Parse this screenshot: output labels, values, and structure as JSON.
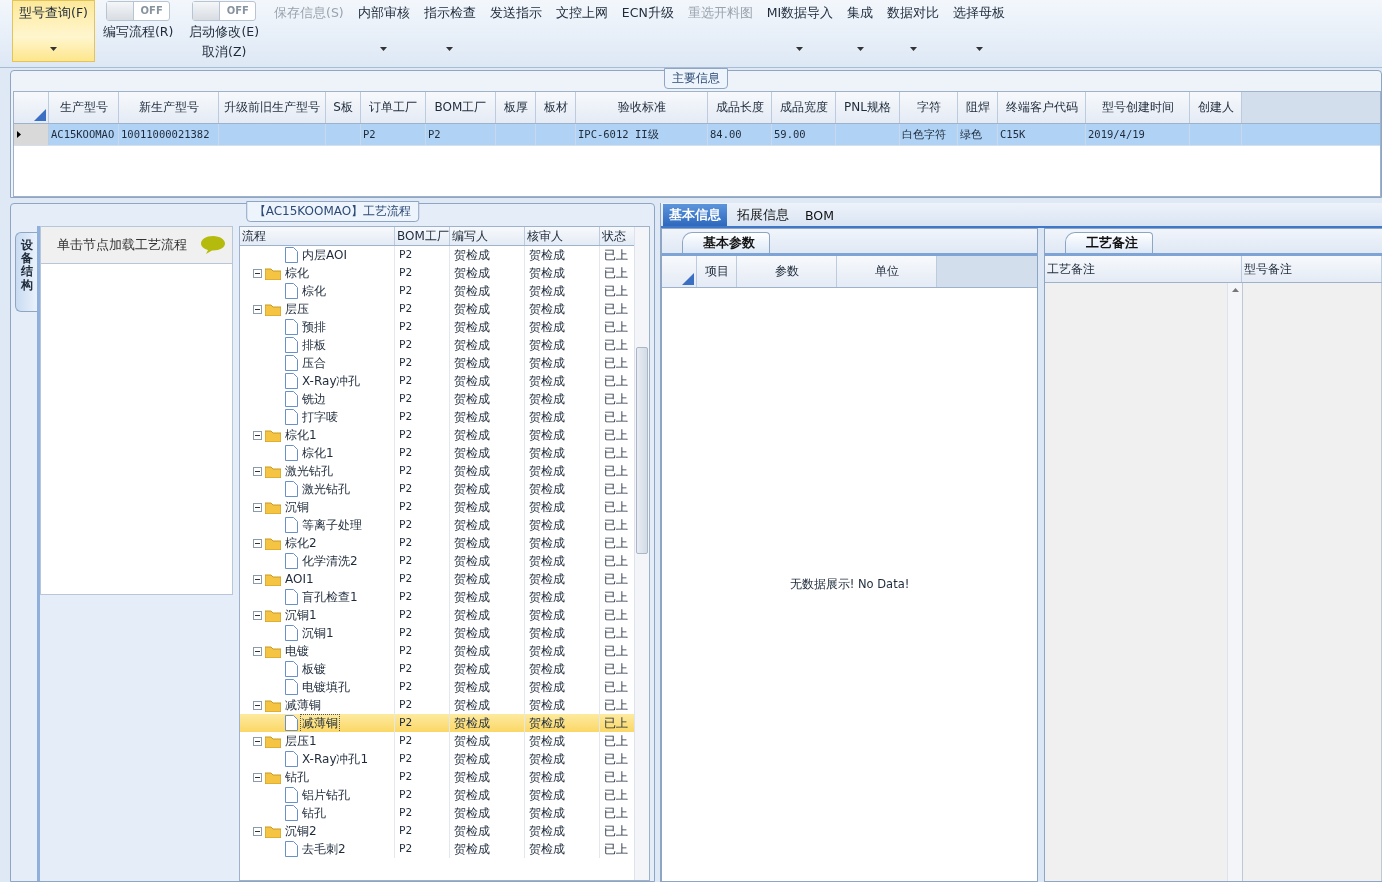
{
  "toolbar": [
    {
      "kind": "button",
      "label": "型号查询(F)",
      "selected": true,
      "disabled": false,
      "dropdown": true
    },
    {
      "kind": "toggle",
      "switch_text": "OFF",
      "label": "编写流程(R)",
      "selected": false,
      "disabled": false
    },
    {
      "kind": "toggle",
      "switch_text": "OFF",
      "label": "启动修改(E)",
      "sublabel": "取消(Z)",
      "selected": false,
      "disabled": false
    },
    {
      "kind": "button",
      "label": "保存信息(S)",
      "selected": false,
      "disabled": true,
      "dropdown": false
    },
    {
      "kind": "button",
      "label": "内部审核",
      "selected": false,
      "disabled": false,
      "dropdown": true
    },
    {
      "kind": "button",
      "label": "指示检查",
      "selected": false,
      "disabled": false,
      "dropdown": true
    },
    {
      "kind": "button",
      "label": "发送指示",
      "selected": false,
      "disabled": false,
      "dropdown": false
    },
    {
      "kind": "button",
      "label": "文控上网",
      "selected": false,
      "disabled": false,
      "dropdown": false
    },
    {
      "kind": "button",
      "label": "ECN升级",
      "selected": false,
      "disabled": false,
      "dropdown": false
    },
    {
      "kind": "button",
      "label": "重选开料图",
      "selected": false,
      "disabled": true,
      "dropdown": false
    },
    {
      "kind": "button",
      "label": "MI数据导入",
      "selected": false,
      "disabled": false,
      "dropdown": true
    },
    {
      "kind": "button",
      "label": "集成",
      "selected": false,
      "disabled": false,
      "dropdown": true
    },
    {
      "kind": "button",
      "label": "数据对比",
      "selected": false,
      "disabled": false,
      "dropdown": true
    },
    {
      "kind": "button",
      "label": "选择母板",
      "selected": false,
      "disabled": false,
      "dropdown": true
    }
  ],
  "main_info": {
    "title": "主要信息",
    "columns": [
      "生产型号",
      "新生产型号",
      "升级前旧生产型号",
      "S板",
      "订单工厂",
      "BOM工厂",
      "板厚",
      "板材",
      "验收标准",
      "成品长度",
      "成品宽度",
      "PNL规格",
      "字符",
      "阻焊",
      "终端客户代码",
      "型号创建时间",
      "创建人"
    ],
    "rows": [
      {
        "selected": true,
        "cells": [
          "AC15KOOMAO",
          "10011000021382",
          "",
          "",
          "P2",
          "P2",
          "",
          "",
          "IPC-6012 II级",
          "84.00",
          "59.00",
          "",
          "白色字符",
          "绿色",
          "C15K",
          "2019/4/19",
          ""
        ]
      }
    ]
  },
  "process": {
    "title": "【AC15KOOMAO】工艺流程",
    "side_tab": "设备结构",
    "hint": "单击节点加载工艺流程",
    "columns": [
      "流程",
      "BOM工厂",
      "编写人",
      "核审人",
      "状态"
    ],
    "tree": [
      {
        "kind": "leaf",
        "label": "内层AOI",
        "selected": false,
        "bom": "P2",
        "writer": "贺检成",
        "reviewer": "贺检成",
        "status": "已上"
      },
      {
        "kind": "folder",
        "label": "棕化",
        "expanded": true,
        "selected": false,
        "bom": "P2",
        "writer": "贺检成",
        "reviewer": "贺检成",
        "status": "已上",
        "children": [
          {
            "kind": "leaf",
            "label": "棕化",
            "selected": false,
            "bom": "P2",
            "writer": "贺检成",
            "reviewer": "贺检成",
            "status": "已上"
          }
        ]
      },
      {
        "kind": "folder",
        "label": "层压",
        "expanded": true,
        "selected": false,
        "bom": "P2",
        "writer": "贺检成",
        "reviewer": "贺检成",
        "status": "已上",
        "children": [
          {
            "kind": "leaf",
            "label": "预排",
            "selected": false,
            "bom": "P2",
            "writer": "贺检成",
            "reviewer": "贺检成",
            "status": "已上"
          },
          {
            "kind": "leaf",
            "label": "排板",
            "selected": false,
            "bom": "P2",
            "writer": "贺检成",
            "reviewer": "贺检成",
            "status": "已上"
          },
          {
            "kind": "leaf",
            "label": "压合",
            "selected": false,
            "bom": "P2",
            "writer": "贺检成",
            "reviewer": "贺检成",
            "status": "已上"
          },
          {
            "kind": "leaf",
            "label": "X-Ray冲孔",
            "selected": false,
            "bom": "P2",
            "writer": "贺检成",
            "reviewer": "贺检成",
            "status": "已上"
          },
          {
            "kind": "leaf",
            "label": "铣边",
            "selected": false,
            "bom": "P2",
            "writer": "贺检成",
            "reviewer": "贺检成",
            "status": "已上"
          },
          {
            "kind": "leaf",
            "label": "打字唛",
            "selected": false,
            "bom": "P2",
            "writer": "贺检成",
            "reviewer": "贺检成",
            "status": "已上"
          }
        ]
      },
      {
        "kind": "folder",
        "label": "棕化1",
        "expanded": true,
        "selected": false,
        "bom": "P2",
        "writer": "贺检成",
        "reviewer": "贺检成",
        "status": "已上",
        "children": [
          {
            "kind": "leaf",
            "label": "棕化1",
            "selected": false,
            "bom": "P2",
            "writer": "贺检成",
            "reviewer": "贺检成",
            "status": "已上"
          }
        ]
      },
      {
        "kind": "folder",
        "label": "激光钻孔",
        "expanded": true,
        "selected": false,
        "bom": "P2",
        "writer": "贺检成",
        "reviewer": "贺检成",
        "status": "已上",
        "children": [
          {
            "kind": "leaf",
            "label": "激光钻孔",
            "selected": false,
            "bom": "P2",
            "writer": "贺检成",
            "reviewer": "贺检成",
            "status": "已上"
          }
        ]
      },
      {
        "kind": "folder",
        "label": "沉铜",
        "expanded": true,
        "selected": false,
        "bom": "P2",
        "writer": "贺检成",
        "reviewer": "贺检成",
        "status": "已上",
        "children": [
          {
            "kind": "leaf",
            "label": "等离子处理",
            "selected": false,
            "bom": "P2",
            "writer": "贺检成",
            "reviewer": "贺检成",
            "status": "已上"
          }
        ]
      },
      {
        "kind": "folder",
        "label": "棕化2",
        "expanded": true,
        "selected": false,
        "bom": "P2",
        "writer": "贺检成",
        "reviewer": "贺检成",
        "status": "已上",
        "children": [
          {
            "kind": "leaf",
            "label": "化学清洗2",
            "selected": false,
            "bom": "P2",
            "writer": "贺检成",
            "reviewer": "贺检成",
            "status": "已上"
          }
        ]
      },
      {
        "kind": "folder",
        "label": "AOI1",
        "expanded": true,
        "selected": false,
        "bom": "P2",
        "writer": "贺检成",
        "reviewer": "贺检成",
        "status": "已上",
        "children": [
          {
            "kind": "leaf",
            "label": "盲孔检查1",
            "selected": false,
            "bom": "P2",
            "writer": "贺检成",
            "reviewer": "贺检成",
            "status": "已上"
          }
        ]
      },
      {
        "kind": "folder",
        "label": "沉铜1",
        "expanded": true,
        "selected": false,
        "bom": "P2",
        "writer": "贺检成",
        "reviewer": "贺检成",
        "status": "已上",
        "children": [
          {
            "kind": "leaf",
            "label": "沉铜1",
            "selected": false,
            "bom": "P2",
            "writer": "贺检成",
            "reviewer": "贺检成",
            "status": "已上"
          }
        ]
      },
      {
        "kind": "folder",
        "label": "电镀",
        "expanded": true,
        "selected": false,
        "bom": "P2",
        "writer": "贺检成",
        "reviewer": "贺检成",
        "status": "已上",
        "children": [
          {
            "kind": "leaf",
            "label": "板镀",
            "selected": false,
            "bom": "P2",
            "writer": "贺检成",
            "reviewer": "贺检成",
            "status": "已上"
          },
          {
            "kind": "leaf",
            "label": "电镀填孔",
            "selected": false,
            "bom": "P2",
            "writer": "贺检成",
            "reviewer": "贺检成",
            "status": "已上"
          }
        ]
      },
      {
        "kind": "folder",
        "label": "减薄铜",
        "expanded": true,
        "selected": false,
        "bom": "P2",
        "writer": "贺检成",
        "reviewer": "贺检成",
        "status": "已上",
        "children": [
          {
            "kind": "leaf",
            "label": "减薄铜",
            "selected": true,
            "bom": "P2",
            "writer": "贺检成",
            "reviewer": "贺检成",
            "status": "已上"
          }
        ]
      },
      {
        "kind": "folder",
        "label": "层压1",
        "expanded": true,
        "selected": false,
        "bom": "P2",
        "writer": "贺检成",
        "reviewer": "贺检成",
        "status": "已上",
        "children": [
          {
            "kind": "leaf",
            "label": "X-Ray冲孔1",
            "selected": false,
            "bom": "P2",
            "writer": "贺检成",
            "reviewer": "贺检成",
            "status": "已上"
          }
        ]
      },
      {
        "kind": "folder",
        "label": "钻孔",
        "expanded": true,
        "selected": false,
        "bom": "P2",
        "writer": "贺检成",
        "reviewer": "贺检成",
        "status": "已上",
        "children": [
          {
            "kind": "leaf",
            "label": "铝片钻孔",
            "selected": false,
            "bom": "P2",
            "writer": "贺检成",
            "reviewer": "贺检成",
            "status": "已上"
          },
          {
            "kind": "leaf",
            "label": "钻孔",
            "selected": false,
            "bom": "P2",
            "writer": "贺检成",
            "reviewer": "贺检成",
            "status": "已上"
          }
        ]
      },
      {
        "kind": "folder",
        "label": "沉铜2",
        "expanded": true,
        "selected": false,
        "bom": "P2",
        "writer": "贺检成",
        "reviewer": "贺检成",
        "status": "已上",
        "children": [
          {
            "kind": "leaf",
            "label": "去毛刺2",
            "selected": false,
            "bom": "P2",
            "writer": "贺检成",
            "reviewer": "贺检成",
            "status": "已上"
          }
        ]
      }
    ]
  },
  "detail_tabs": [
    {
      "label": "基本信息",
      "selected": true
    },
    {
      "label": "拓展信息",
      "selected": false
    },
    {
      "label": "BOM",
      "selected": false
    }
  ],
  "basic_params": {
    "tab": "基本参数",
    "columns": [
      "项目",
      "参数",
      "单位"
    ],
    "empty_text": "无数据展示! No Data!"
  },
  "remarks": {
    "tab": "工艺备注",
    "columns": [
      "工艺备注",
      "型号备注"
    ]
  }
}
